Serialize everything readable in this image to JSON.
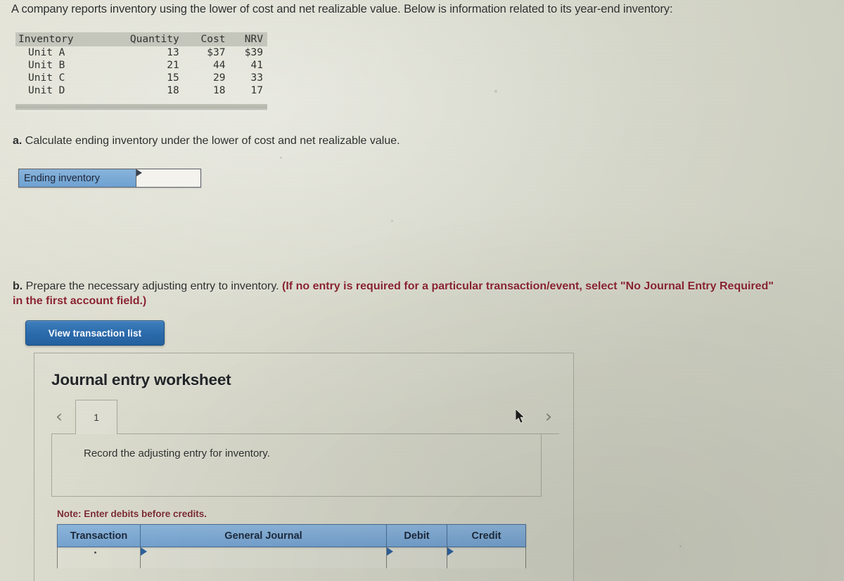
{
  "intro": {
    "text": "A company reports inventory using the lower of cost and net realizable value. Below is information related to its year-end inventory:"
  },
  "inventory_table": {
    "columns": [
      "Inventory",
      "Quantity",
      "Cost",
      "NRV"
    ],
    "rows": [
      {
        "inventory": "Unit A",
        "quantity": "13",
        "cost": "$37",
        "nrv": "$39"
      },
      {
        "inventory": "Unit B",
        "quantity": "21",
        "cost": "44",
        "nrv": "41"
      },
      {
        "inventory": "Unit C",
        "quantity": "15",
        "cost": "29",
        "nrv": "33"
      },
      {
        "inventory": "Unit D",
        "quantity": "18",
        "cost": "18",
        "nrv": "17"
      }
    ]
  },
  "part_a": {
    "label": "a.",
    "question": "Calculate ending inventory under the lower of cost and net realizable value.",
    "row_label": "Ending inventory",
    "input_value": "",
    "input_placeholder": ""
  },
  "part_b": {
    "label": "b.",
    "question": "Prepare the necessary adjusting entry to inventory.",
    "requirement": "(If no entry is required for a particular transaction/event, select \"No Journal Entry Required\" in the first account field.)",
    "view_transaction_list_label": "View transaction list"
  },
  "worksheet": {
    "title": "Journal entry worksheet",
    "prev_icon": "chevron-left-icon",
    "next_icon": "chevron-right-icon",
    "tabs": [
      {
        "label": "1",
        "active": true
      }
    ],
    "prompt": "Record the adjusting entry for inventory.",
    "note": "Note: Enter debits before credits.",
    "journal_table": {
      "columns": [
        "Transaction",
        "General Journal",
        "Debit",
        "Credit"
      ],
      "rows": [
        {
          "transaction": "",
          "general_journal": "",
          "debit": "",
          "credit": ""
        }
      ]
    }
  },
  "colors": {
    "page_background": "#d6d7c9",
    "header_blue": "#76a4d2",
    "button_blue": "#2b6bad",
    "requirement_red": "#8b2330",
    "note_red": "#7d2b33",
    "table_header_gray": "#c6c7bd",
    "border_gray": "#a9aa9e"
  }
}
